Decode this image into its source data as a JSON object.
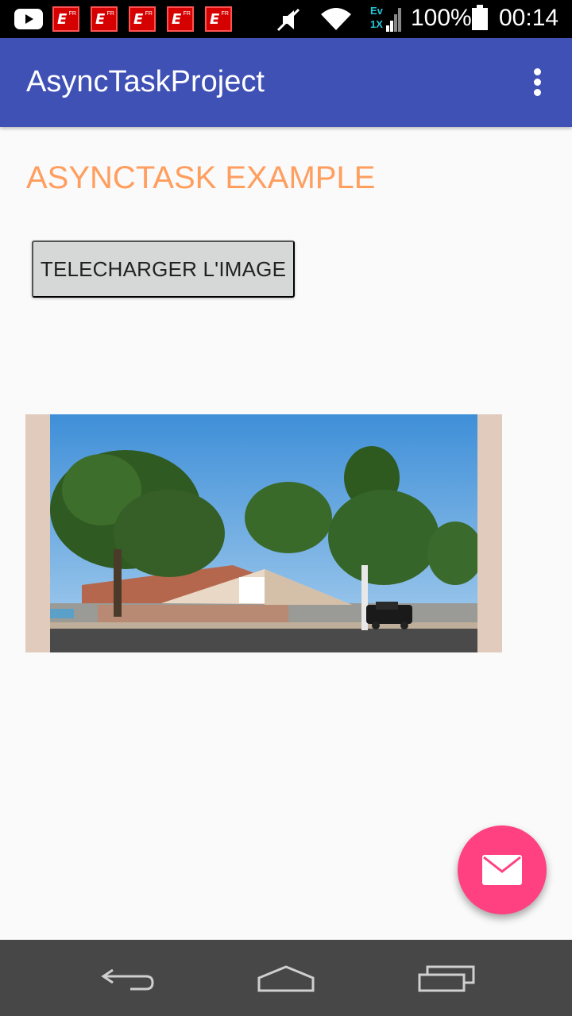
{
  "status_bar": {
    "battery_text": "100%",
    "time": "00:14",
    "network_type": "Ev",
    "network_sub": "1X",
    "notification_badge_letter": "E",
    "notification_badge_suffix": "FR",
    "icons": [
      "youtube-icon",
      "e-fr-notification-icon",
      "mute-icon",
      "wifi-icon",
      "signal-icon",
      "battery-icon"
    ]
  },
  "app_bar": {
    "title": "AsyncTaskProject",
    "background": "#3f51b5"
  },
  "content": {
    "heading": "ASYNCTASK EXAMPLE",
    "heading_color": "#ff9e5e",
    "download_button": "TELECHARGER L'IMAGE"
  },
  "fab": {
    "icon": "email-icon",
    "color": "#ff4081"
  },
  "nav_bar": {
    "icons": [
      "back-icon",
      "home-icon",
      "recents-icon"
    ]
  }
}
